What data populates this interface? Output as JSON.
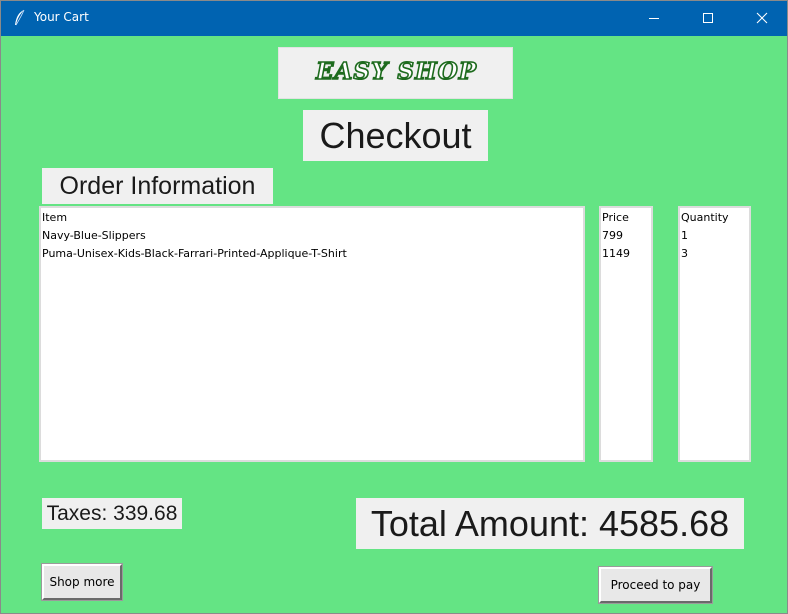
{
  "window": {
    "title": "Your Cart",
    "controls": [
      "minimize-icon",
      "maximize-icon",
      "close-icon"
    ],
    "background_color": "#64e484",
    "titlebar_color": "#0063b1"
  },
  "brand": {
    "logo_text": "EASY SHOP"
  },
  "page": {
    "heading": "Checkout",
    "section_label": "Order Information"
  },
  "order": {
    "columns": {
      "item": "Item",
      "price": "Price",
      "quantity": "Quantity"
    },
    "items": [
      {
        "name": "Navy-Blue-Slippers",
        "price": "799",
        "quantity": "1"
      },
      {
        "name": "Puma-Unisex-Kids-Black-Farrari-Printed-Applique-T-Shirt",
        "price": "1149",
        "quantity": "3"
      }
    ]
  },
  "summary": {
    "taxes": "Taxes: 339.68",
    "total": "Total Amount: 4585.68"
  },
  "actions": {
    "shop_more": "Shop more",
    "proceed": "Proceed to pay"
  }
}
